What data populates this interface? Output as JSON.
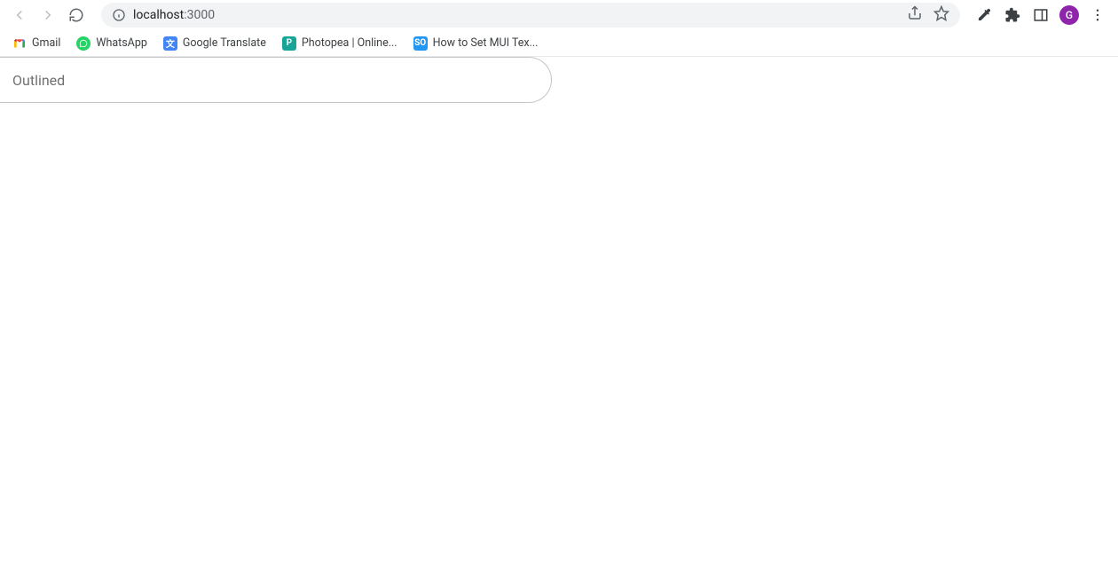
{
  "addressBar": {
    "host": "localhost",
    "port": ":3000"
  },
  "bookmarks": [
    {
      "label": "Gmail",
      "iconKey": "gmail"
    },
    {
      "label": "WhatsApp",
      "iconKey": "whatsapp"
    },
    {
      "label": "Google Translate",
      "iconKey": "translate"
    },
    {
      "label": "Photopea | Online...",
      "iconKey": "photopea"
    },
    {
      "label": "How to Set MUI Tex...",
      "iconKey": "so"
    }
  ],
  "avatar": {
    "letter": "G"
  },
  "page": {
    "textfield": {
      "placeholder": "Outlined",
      "value": ""
    }
  }
}
